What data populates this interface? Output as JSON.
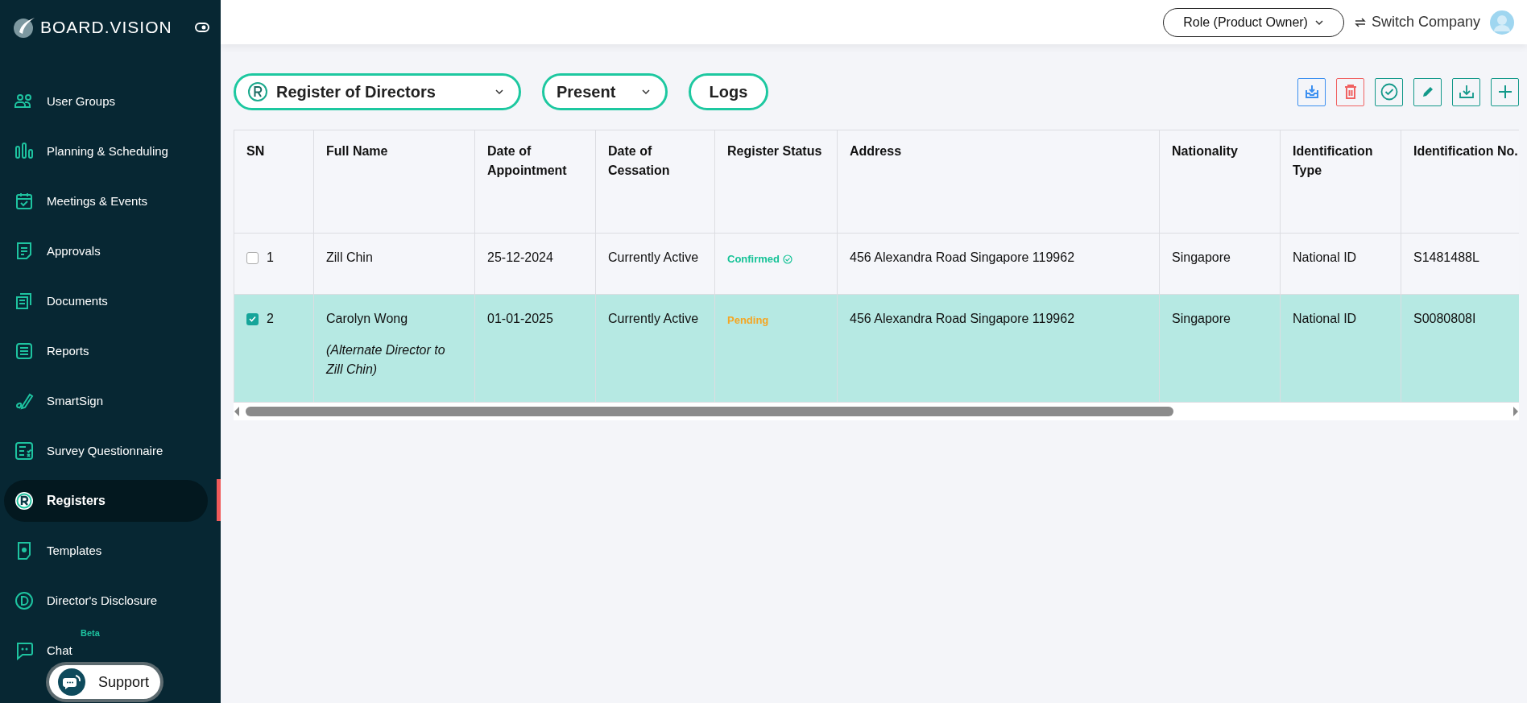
{
  "logo": {
    "text": "BOARD.VISION"
  },
  "sidebar": {
    "items": [
      {
        "label": "User Groups",
        "selected": false
      },
      {
        "label": "Planning & Scheduling",
        "selected": false
      },
      {
        "label": "Meetings & Events",
        "selected": false
      },
      {
        "label": "Approvals",
        "selected": false
      },
      {
        "label": "Documents",
        "selected": false
      },
      {
        "label": "Reports",
        "selected": false
      },
      {
        "label": "SmartSign",
        "selected": false
      },
      {
        "label": "Survey Questionnaire",
        "selected": false
      },
      {
        "label": "Registers",
        "selected": true
      },
      {
        "label": "Templates",
        "selected": false
      },
      {
        "label": "Director's Disclosure",
        "selected": false
      },
      {
        "label": "Chat",
        "selected": false,
        "badge": "Beta"
      }
    ]
  },
  "support": {
    "label": "Support"
  },
  "header": {
    "role": "Role (Product Owner)",
    "switch_company": "Switch Company"
  },
  "toolbar": {
    "register_select": "Register of Directors",
    "period_select": "Present",
    "logs": "Logs"
  },
  "table": {
    "columns": [
      "SN",
      "Full Name",
      "Date of Appointment",
      "Date of Cessation",
      "Register Status",
      "Address",
      "Nationality",
      "Identification Type",
      "Identification No."
    ],
    "rows": [
      {
        "selected": false,
        "sn": "1",
        "full_name": "Zill Chin",
        "appointment": "25-12-2024",
        "cessation": "Currently Active",
        "status": {
          "label": "Confirmed",
          "kind": "confirmed"
        },
        "address": "456 Alexandra Road Singapore 119962",
        "nationality": "Singapore",
        "id_type": "National ID",
        "id_no": "S1481488L"
      },
      {
        "selected": true,
        "sn": "2",
        "full_name": "Carolyn Wong",
        "note": "(Alternate Director to Zill Chin)",
        "appointment": "01-01-2025",
        "cessation": "Currently Active",
        "status": {
          "label": "Pending",
          "kind": "pending"
        },
        "address": "456 Alexandra Road Singapore 119962",
        "nationality": "Singapore",
        "id_type": "National ID",
        "id_no": "S0080808I"
      }
    ]
  }
}
